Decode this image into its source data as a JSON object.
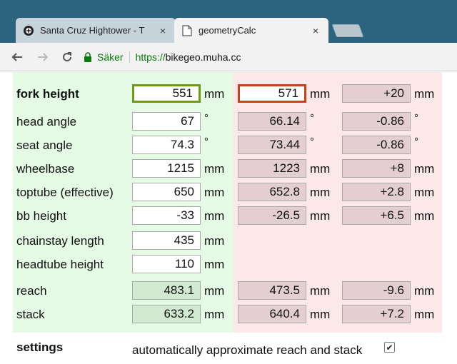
{
  "browser": {
    "tabs": [
      {
        "title": "Santa Cruz Hightower - T",
        "icon": "santa-cruz-favicon"
      },
      {
        "title": "geometryCalc",
        "icon": "document-icon"
      }
    ],
    "close_glyph": "×",
    "omnibox": {
      "security_label": "Säker",
      "url_scheme": "https://",
      "url_host": "bikegeo.muha.cc"
    }
  },
  "rows": [
    {
      "label": "fork height",
      "a": "551",
      "b": "571",
      "c": "+20",
      "unit": "mm"
    },
    {
      "label": "head angle",
      "a": "67",
      "b": "66.14",
      "c": "-0.86",
      "unit": "°"
    },
    {
      "label": "seat angle",
      "a": "74.3",
      "b": "73.44",
      "c": "-0.86",
      "unit": "°"
    },
    {
      "label": "wheelbase",
      "a": "1215",
      "b": "1223",
      "c": "+8",
      "unit": "mm"
    },
    {
      "label": "toptube (effective)",
      "a": "650",
      "b": "652.8",
      "c": "+2.8",
      "unit": "mm"
    },
    {
      "label": "bb height",
      "a": "-33",
      "b": "-26.5",
      "c": "+6.5",
      "unit": "mm"
    },
    {
      "label": "chainstay length",
      "a": "435",
      "unit": "mm"
    },
    {
      "label": "headtube height",
      "a": "110",
      "unit": "mm"
    },
    {
      "label": "reach",
      "a": "483.1",
      "b": "473.5",
      "c": "-9.6",
      "unit": "mm"
    },
    {
      "label": "stack",
      "a": "633.2",
      "b": "640.4",
      "c": "+7.2",
      "unit": "mm"
    }
  ],
  "settings": {
    "label": "settings",
    "option_text": "automatically approximate reach and stack",
    "option_checked": true,
    "check_glyph": "✔"
  },
  "colors": {
    "left_panel": "#e6fbe6",
    "right_panel": "#fce8e8",
    "active_original_border": "#6f9a12",
    "active_new_border": "#c9421a",
    "tabstrip": "#2c6480"
  }
}
